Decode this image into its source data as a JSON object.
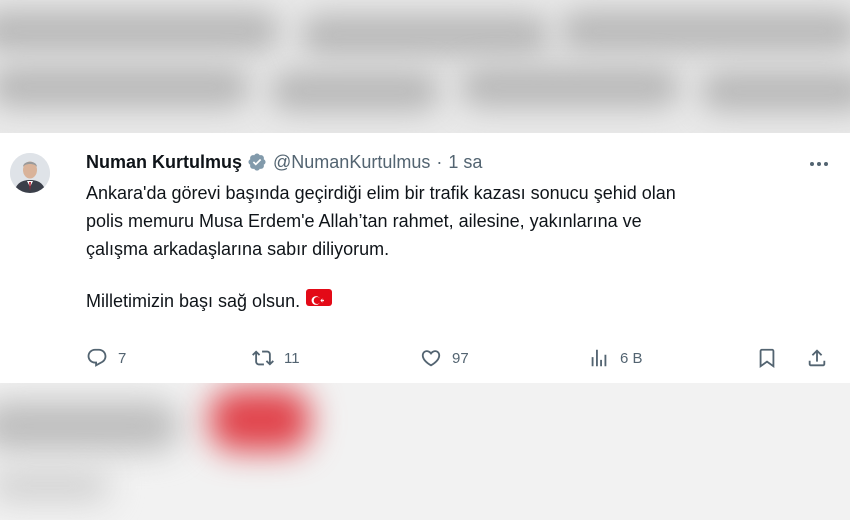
{
  "tweet": {
    "author_name": "Numan Kurtulmuş",
    "handle": "@NumanKurtulmus",
    "separator": "·",
    "time": "1 sa",
    "text_lines": [
      "Ankara'da görevi başında geçirdiği elim bir trafik kazası sonucu şehid olan",
      "polis memuru Musa Erdem'e Allah’tan rahmet, ailesine, yakınlarına ve",
      "çalışma arkadaşlarına sabır diliyorum."
    ],
    "closing_line": "Milletimizin başı sağ olsun.",
    "flag_emoji": "turkish-flag"
  },
  "actions": {
    "replies": "7",
    "reposts": "11",
    "likes": "97",
    "views": "6 B"
  },
  "colors": {
    "text": "#0f1419",
    "muted": "#536471",
    "verified_badge": "#829aab",
    "flag_red": "#e30a17"
  },
  "icons": [
    "avatar",
    "verified-badge-icon",
    "more-icon",
    "reply-icon",
    "repost-icon",
    "like-icon",
    "views-icon",
    "bookmark-icon",
    "share-icon"
  ]
}
